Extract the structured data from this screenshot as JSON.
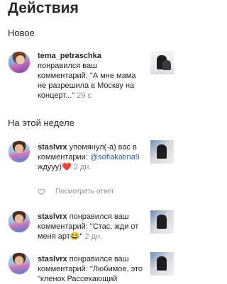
{
  "header": {
    "title": "Действия"
  },
  "sections": {
    "new": "Новое",
    "this_week": "На этой неделе"
  },
  "notifications": [
    {
      "username": "tema_petraschka",
      "text": "понравился ваш комментарий: \"А мне мама не разрешила в Москву на концерт...\"",
      "time": "29 с"
    },
    {
      "username": "staslvrx",
      "text_before": "упомянул(-а) вас в комментарии:",
      "mention": "@sofiakatina9",
      "text_after": "ждууу)",
      "emoji": "❤️",
      "time": "2 дн.",
      "actions": {
        "like_icon": "heart-outline-icon",
        "view_reply": "Посмотреть ответ"
      }
    },
    {
      "username": "staslvrx",
      "text": "понравился ваш комментарий: \"Стас, жди от меня арт",
      "emoji": "😂",
      "text_end": "\"",
      "time": "2 дн."
    },
    {
      "username": "staslvrx",
      "text": "понравился ваш комментарий: \"Любимое, это \"кленок Рассекающий"
    }
  ]
}
